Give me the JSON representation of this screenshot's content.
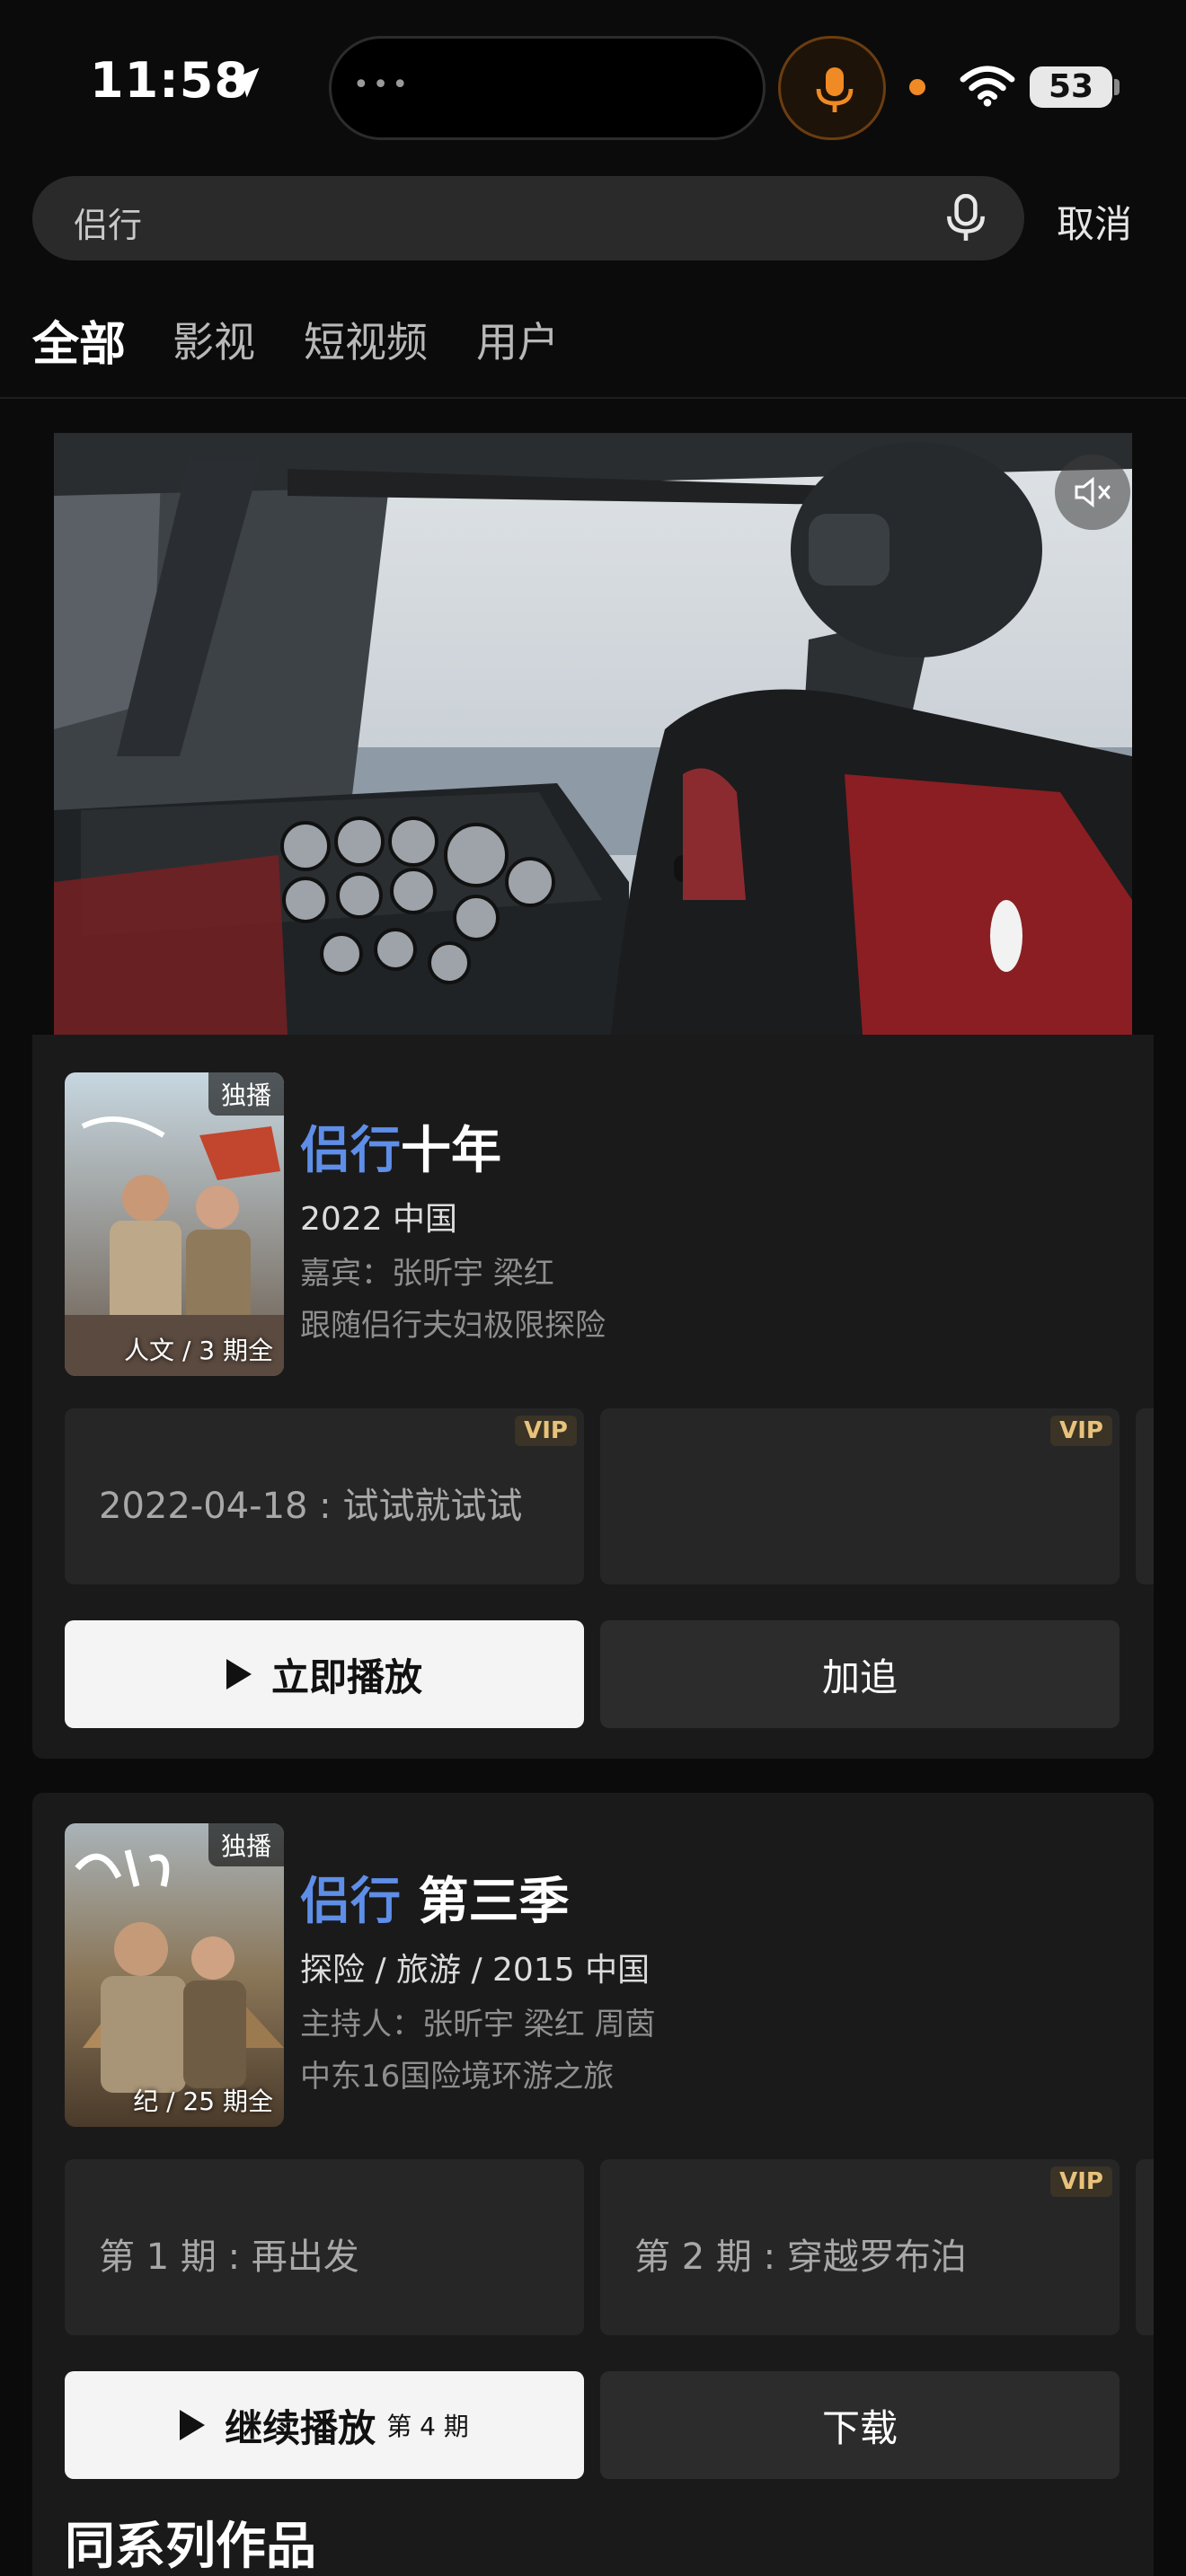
{
  "status": {
    "time": "11:58",
    "battery": "53"
  },
  "search": {
    "query": "侣行",
    "cancel": "取消"
  },
  "tabs": [
    {
      "label": "全部",
      "active": true
    },
    {
      "label": "影视",
      "active": false
    },
    {
      "label": "短视频",
      "active": false
    },
    {
      "label": "用户",
      "active": false
    }
  ],
  "results": [
    {
      "badge": "独播",
      "poster_caption": "人文 / 3 期全",
      "title_highlight": "侣行",
      "title_rest": "十年",
      "meta": "2022 中国",
      "cast": "嘉宾：张昕宇 梁红",
      "desc": "跟随侣行夫妇极限探险",
      "episodes": [
        {
          "label": "2022-04-18 : 试试就试试",
          "vip": "VIP"
        },
        {
          "label": "",
          "vip": "VIP"
        }
      ],
      "primary_btn": "立即播放",
      "secondary_btn": "加追"
    },
    {
      "badge": "独播",
      "poster_caption": "纪 / 25 期全",
      "title_highlight": "侣行",
      "title_rest": " 第三季",
      "meta": "探险 / 旅游 / 2015 中国",
      "cast": "主持人：张昕宇 梁红 周茵",
      "desc": "中东16国险境环游之旅",
      "episodes": [
        {
          "label": "第 1 期 : 再出发",
          "vip": ""
        },
        {
          "label": "第 2 期 : 穿越罗布泊",
          "vip": "VIP"
        }
      ],
      "primary_btn": "继续播放",
      "primary_btn_sub": "第 4 期",
      "secondary_btn": "下载"
    }
  ],
  "section_title": "同系列作品",
  "colors": {
    "highlight": "#5e8ee8",
    "vip": "#e8c27a",
    "mic_accent": "#f08a24"
  },
  "icons": [
    "location-arrow-icon",
    "microphone-icon",
    "wifi-icon",
    "battery-icon",
    "voice-search-icon",
    "mute-icon",
    "play-icon"
  ]
}
